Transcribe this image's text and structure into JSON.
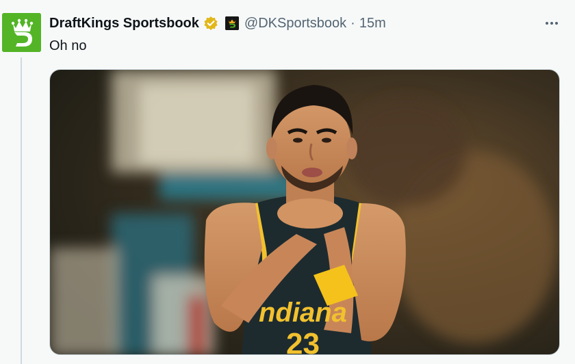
{
  "tweet": {
    "display_name": "DraftKings Sportsbook",
    "handle": "@DKSportsbook",
    "separator": "·",
    "time": "15m",
    "text": "Oh no",
    "more_label": "•••",
    "media": {
      "jersey_text": "ndiana",
      "jersey_number": "23"
    }
  },
  "colors": {
    "avatar_bg": "#53b426",
    "verified": "#e2b719",
    "text_primary": "#0f1419",
    "text_secondary": "#536471",
    "jersey": "#1d2b2f",
    "jersey_trim": "#f2c12e",
    "wristband": "#f5c21b"
  },
  "icons": {
    "avatar": "draftkings-crown-logo",
    "verified": "verified-badge-icon",
    "affiliation": "affiliate-badge-icon",
    "more": "more-dots-icon"
  }
}
